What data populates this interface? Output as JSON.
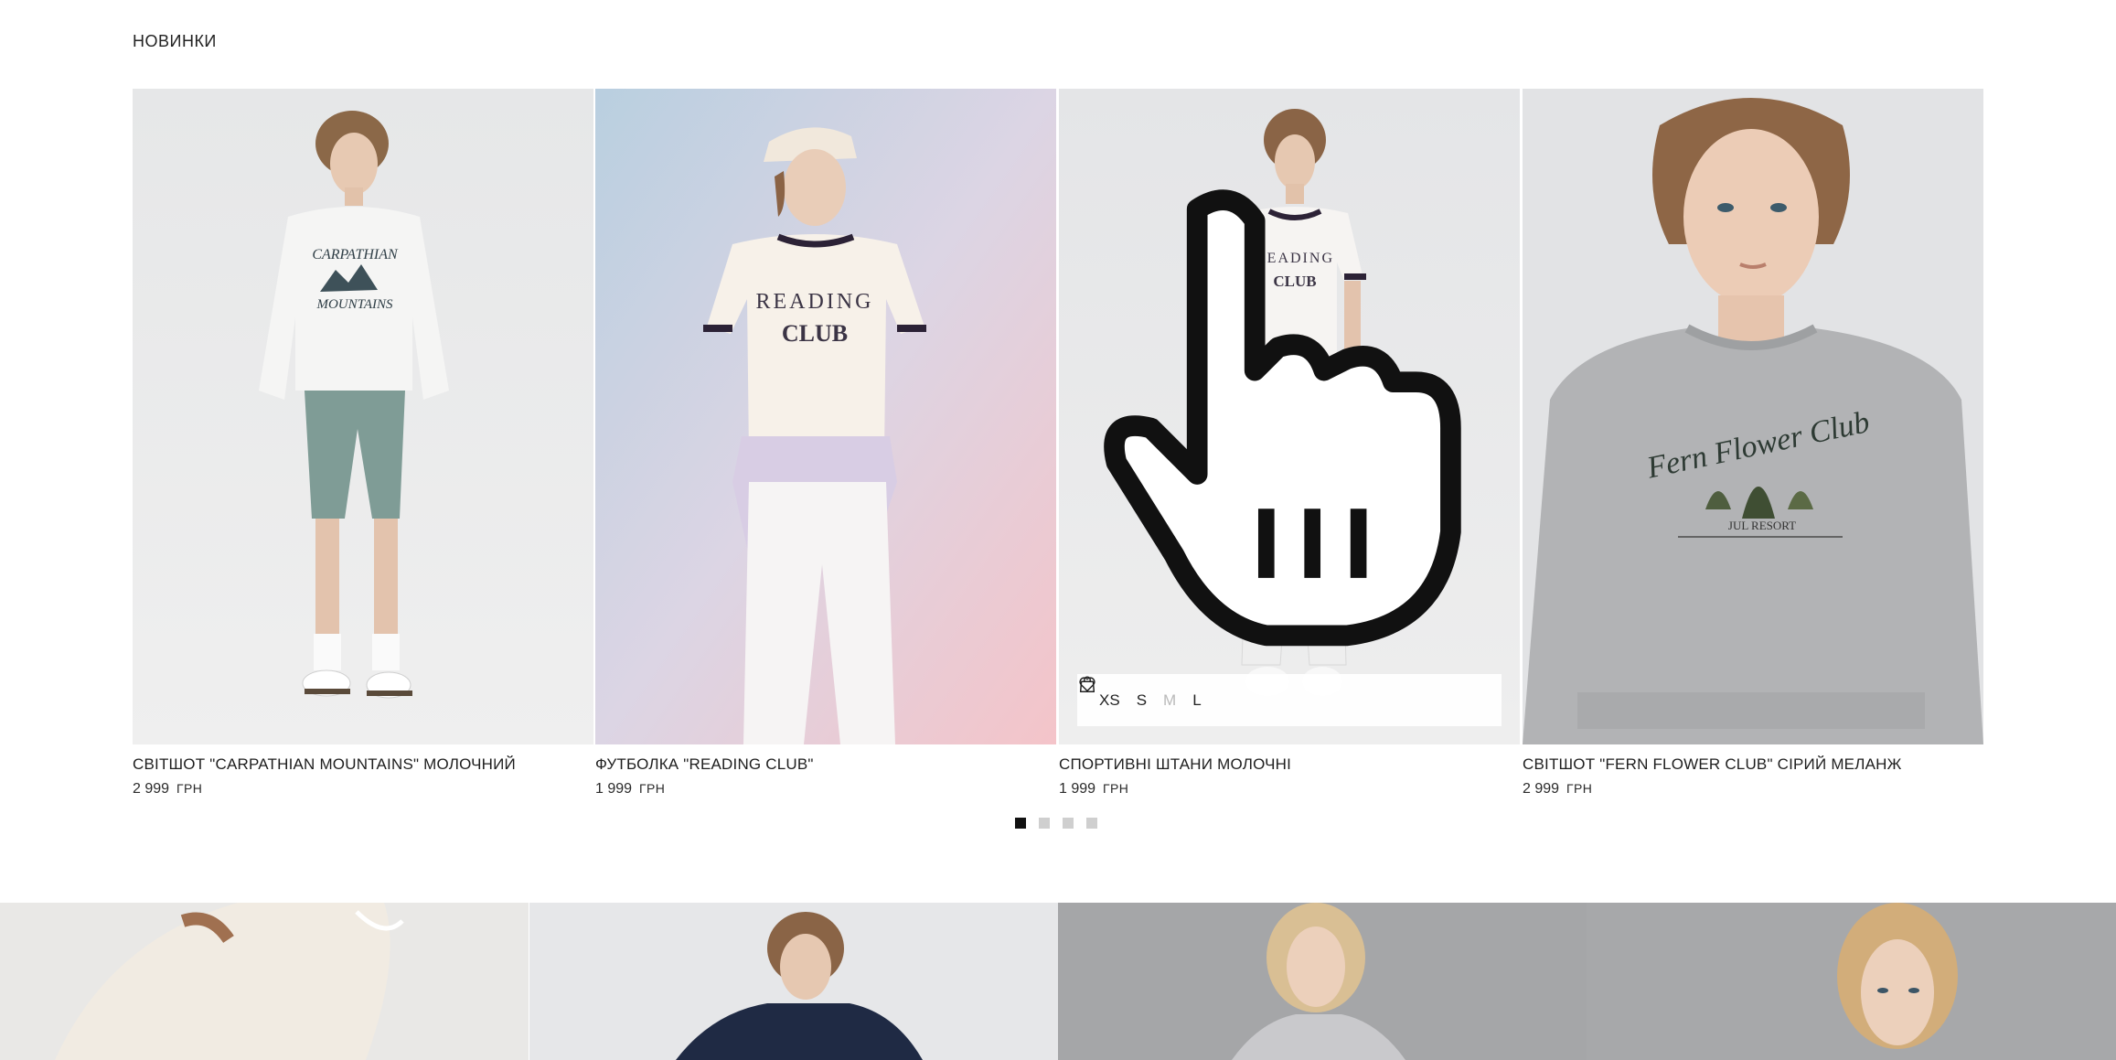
{
  "section": {
    "title": "НОВИНКИ"
  },
  "products": [
    {
      "title": "СВІТШОТ \"CARPATHIAN MOUNTAINS\" МОЛОЧНИЙ",
      "price": "2 999",
      "currency": "ГРН",
      "print_lines": [
        "CARPATHIAN",
        "MOUNTAINS"
      ]
    },
    {
      "title": "ФУТБОЛКА \"READING CLUB\"",
      "price": "1 999",
      "currency": "ГРН",
      "print_lines": [
        "READING",
        "CLUB"
      ]
    },
    {
      "title": "СПОРТИВНІ ШТАНИ МОЛОЧНІ",
      "price": "1 999",
      "currency": "ГРН",
      "print_lines": [
        "READING",
        "CLUB"
      ]
    },
    {
      "title": "СВІТШОТ \"FERN FLOWER CLUB\" СІРИЙ МЕЛАНЖ",
      "price": "2 999",
      "currency": "ГРН",
      "print_lines": [
        "Fern Flower Club",
        "JUL RESORT"
      ]
    }
  ],
  "quick_panel": {
    "sizes": [
      {
        "label": "XS",
        "available": true
      },
      {
        "label": "S",
        "available": true
      },
      {
        "label": "M",
        "available": false
      },
      {
        "label": "L",
        "available": true
      }
    ],
    "icons": [
      "heart-icon",
      "bag-icon"
    ]
  },
  "pagination": {
    "pages": 4,
    "active": 1
  },
  "colors": {
    "accent": "#111111",
    "inactive_dot": "#cfcfcf",
    "disabled_size": "#b9b9b9"
  }
}
